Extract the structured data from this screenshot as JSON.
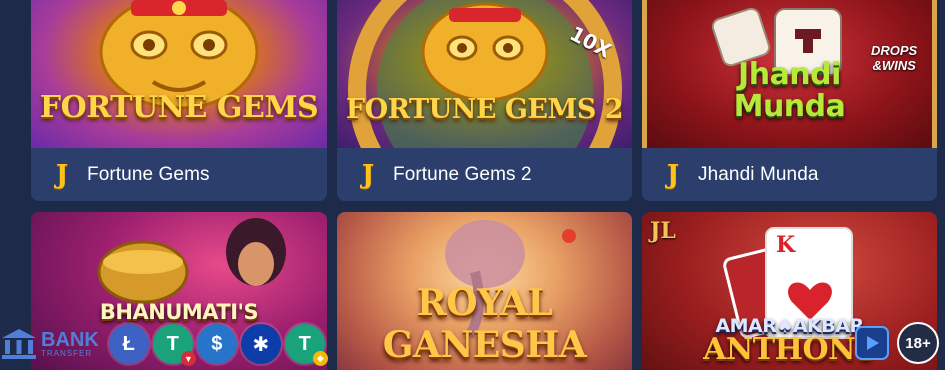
{
  "games_row1": [
    {
      "name": "Fortune Gems",
      "thumb_title": "FORTUNE GEMS",
      "provider_glyph": "J"
    },
    {
      "name": "Fortune Gems 2",
      "thumb_title": "FORTUNE GEMS 2",
      "provider_glyph": "J"
    },
    {
      "name": "Jhandi Munda",
      "thumb_title_line1": "Jhandi",
      "thumb_title_line2": "Munda",
      "provider_glyph": "J",
      "promo_line1": "DROPS",
      "promo_line2": "&WINS"
    }
  ],
  "games_row2": [
    {
      "thumb_title_line1": "BHANUMATI'S"
    },
    {
      "thumb_title_line1": "ROYAL",
      "thumb_title_line2": "GANESHA"
    },
    {
      "thumb_title_line1": "AMAR♠AKBAR",
      "thumb_title_line2": "ANTHONY",
      "tag": "JL",
      "card_rank": "K"
    }
  ],
  "wheel_label": "10X",
  "payments": {
    "bank_label": "BANK",
    "bank_sub": "TRANSFER",
    "coins": [
      {
        "icon": "litecoin-icon",
        "glyph": "Ł",
        "color": "#3d62c4"
      },
      {
        "icon": "tether-tron-icon",
        "glyph": "T",
        "color": "#1aa37a",
        "badge_color": "#d62d3a"
      },
      {
        "icon": "usdc-icon",
        "glyph": "$",
        "color": "#2775ca"
      },
      {
        "icon": "cardano-icon",
        "glyph": "✱",
        "color": "#0d3da8"
      },
      {
        "icon": "tether-bnb-icon",
        "glyph": "T",
        "color": "#1aa37a",
        "badge_color": "#f0b90b"
      }
    ]
  },
  "age_label": "18+"
}
